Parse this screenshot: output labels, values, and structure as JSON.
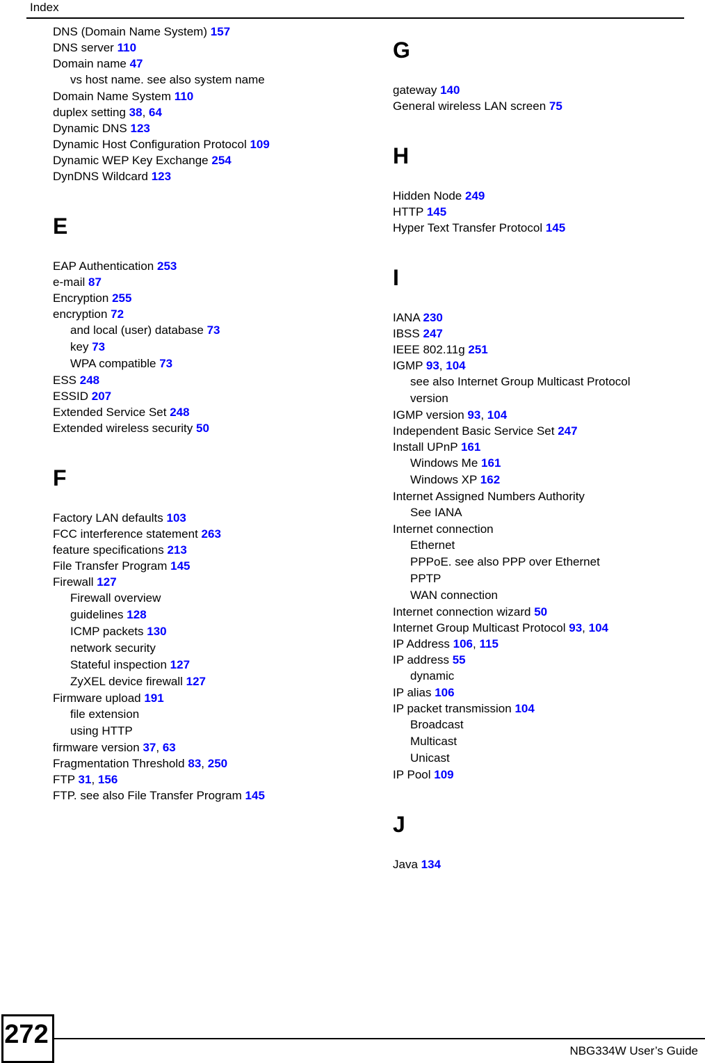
{
  "header": {
    "title": "Index"
  },
  "footer": {
    "page_number": "272",
    "guide_title": "NBG334W User’s Guide"
  },
  "columns": [
    {
      "id": "left",
      "blocks": [
        {
          "type": "entries",
          "entries": [
            {
              "text": "DNS (Domain Name System)",
              "pages": [
                "157"
              ],
              "level": 0
            },
            {
              "text": "DNS server",
              "pages": [
                "110"
              ],
              "level": 0
            },
            {
              "text": "Domain name",
              "pages": [
                "47"
              ],
              "level": 0
            },
            {
              "text": "vs host name. see also system name",
              "pages": [],
              "level": 1
            },
            {
              "text": "Domain Name System",
              "pages": [
                "110"
              ],
              "level": 0
            },
            {
              "text": "duplex setting",
              "pages": [
                "38",
                "64"
              ],
              "level": 0
            },
            {
              "text": "Dynamic DNS",
              "pages": [
                "123"
              ],
              "level": 0
            },
            {
              "text": "Dynamic Host Configuration Protocol",
              "pages": [
                "109"
              ],
              "level": 0
            },
            {
              "text": "Dynamic WEP Key Exchange",
              "pages": [
                "254"
              ],
              "level": 0
            },
            {
              "text": "DynDNS Wildcard",
              "pages": [
                "123"
              ],
              "level": 0
            }
          ]
        },
        {
          "type": "section",
          "letter": "E",
          "entries": [
            {
              "text": "EAP Authentication",
              "pages": [
                "253"
              ],
              "level": 0
            },
            {
              "text": "e-mail",
              "pages": [
                "87"
              ],
              "level": 0
            },
            {
              "text": "Encryption",
              "pages": [
                "255"
              ],
              "level": 0
            },
            {
              "text": "encryption",
              "pages": [
                "72"
              ],
              "level": 0
            },
            {
              "text": "and local (user) database",
              "pages": [
                "73"
              ],
              "level": 1
            },
            {
              "text": "key",
              "pages": [
                "73"
              ],
              "level": 1
            },
            {
              "text": "WPA compatible",
              "pages": [
                "73"
              ],
              "level": 1
            },
            {
              "text": "ESS",
              "pages": [
                "248"
              ],
              "level": 0
            },
            {
              "text": "ESSID",
              "pages": [
                "207"
              ],
              "level": 0
            },
            {
              "text": "Extended Service Set",
              "pages": [
                "248"
              ],
              "level": 0
            },
            {
              "text": "Extended wireless security",
              "pages": [
                "50"
              ],
              "level": 0
            }
          ]
        },
        {
          "type": "section",
          "letter": "F",
          "entries": [
            {
              "text": "Factory LAN defaults",
              "pages": [
                "103"
              ],
              "level": 0
            },
            {
              "text": "FCC interference statement",
              "pages": [
                "263"
              ],
              "level": 0
            },
            {
              "text": "feature specifications",
              "pages": [
                "213"
              ],
              "level": 0
            },
            {
              "text": "File Transfer Program",
              "pages": [
                "145"
              ],
              "level": 0
            },
            {
              "text": "Firewall",
              "pages": [
                "127"
              ],
              "level": 0
            },
            {
              "text": "Firewall overview",
              "pages": [],
              "level": 1
            },
            {
              "text": "guidelines",
              "pages": [
                "128"
              ],
              "level": 1
            },
            {
              "text": "ICMP packets",
              "pages": [
                "130"
              ],
              "level": 1
            },
            {
              "text": "network security",
              "pages": [],
              "level": 1
            },
            {
              "text": "Stateful inspection",
              "pages": [
                "127"
              ],
              "level": 1
            },
            {
              "text": "ZyXEL device firewall",
              "pages": [
                "127"
              ],
              "level": 1
            },
            {
              "text": "Firmware upload",
              "pages": [
                "191"
              ],
              "level": 0
            },
            {
              "text": "file extension",
              "pages": [],
              "level": 1
            },
            {
              "text": "using HTTP",
              "pages": [],
              "level": 1
            },
            {
              "text": "firmware version",
              "pages": [
                "37",
                "63"
              ],
              "level": 0
            },
            {
              "text": "Fragmentation Threshold",
              "pages": [
                "83",
                "250"
              ],
              "level": 0
            },
            {
              "text": "FTP",
              "pages": [
                "31",
                "156"
              ],
              "level": 0
            },
            {
              "text": "FTP. see also File Transfer Program",
              "pages": [
                "145"
              ],
              "level": 0
            }
          ]
        }
      ]
    },
    {
      "id": "right",
      "blocks": [
        {
          "type": "section",
          "letter": "G",
          "first": true,
          "entries": [
            {
              "text": "gateway",
              "pages": [
                "140"
              ],
              "level": 0
            },
            {
              "text": "General wireless LAN screen",
              "pages": [
                "75"
              ],
              "level": 0
            }
          ]
        },
        {
          "type": "section",
          "letter": "H",
          "entries": [
            {
              "text": "Hidden Node",
              "pages": [
                "249"
              ],
              "level": 0
            },
            {
              "text": "HTTP",
              "pages": [
                "145"
              ],
              "level": 0
            },
            {
              "text": "Hyper Text Transfer Protocol",
              "pages": [
                "145"
              ],
              "level": 0
            }
          ]
        },
        {
          "type": "section",
          "letter": "I",
          "entries": [
            {
              "text": "IANA",
              "pages": [
                "230"
              ],
              "level": 0
            },
            {
              "text": "IBSS",
              "pages": [
                "247"
              ],
              "level": 0
            },
            {
              "text": "IEEE 802.11g",
              "pages": [
                "251"
              ],
              "level": 0
            },
            {
              "text": "IGMP",
              "pages": [
                "93",
                "104"
              ],
              "level": 0
            },
            {
              "text": "see also Internet Group Multicast Protocol",
              "pages": [],
              "level": 1
            },
            {
              "text": "version",
              "pages": [],
              "level": 1
            },
            {
              "text": "IGMP version",
              "pages": [
                "93",
                "104"
              ],
              "level": 0
            },
            {
              "text": "Independent Basic Service Set",
              "pages": [
                "247"
              ],
              "level": 0
            },
            {
              "text": "Install UPnP",
              "pages": [
                "161"
              ],
              "level": 0
            },
            {
              "text": "Windows Me",
              "pages": [
                "161"
              ],
              "level": 1
            },
            {
              "text": "Windows XP",
              "pages": [
                "162"
              ],
              "level": 1
            },
            {
              "text": "Internet Assigned Numbers Authority",
              "pages": [],
              "level": 0
            },
            {
              "text": "See IANA",
              "pages": [],
              "level": 1
            },
            {
              "text": "Internet connection",
              "pages": [],
              "level": 0
            },
            {
              "text": "Ethernet",
              "pages": [],
              "level": 1
            },
            {
              "text": "PPPoE. see also PPP over Ethernet",
              "pages": [],
              "level": 1
            },
            {
              "text": "PPTP",
              "pages": [],
              "level": 1
            },
            {
              "text": "WAN connection",
              "pages": [],
              "level": 1
            },
            {
              "text": "Internet connection wizard",
              "pages": [
                "50"
              ],
              "level": 0
            },
            {
              "text": "Internet Group Multicast Protocol",
              "pages": [
                "93",
                "104"
              ],
              "level": 0
            },
            {
              "text": "IP Address",
              "pages": [
                "106",
                "115"
              ],
              "level": 0
            },
            {
              "text": "IP address",
              "pages": [
                "55"
              ],
              "level": 0
            },
            {
              "text": "dynamic",
              "pages": [],
              "level": 1
            },
            {
              "text": "IP alias",
              "pages": [
                "106"
              ],
              "level": 0
            },
            {
              "text": "IP packet transmission",
              "pages": [
                "104"
              ],
              "level": 0
            },
            {
              "text": "Broadcast",
              "pages": [],
              "level": 1
            },
            {
              "text": "Multicast",
              "pages": [],
              "level": 1
            },
            {
              "text": "Unicast",
              "pages": [],
              "level": 1
            },
            {
              "text": "IP Pool",
              "pages": [
                "109"
              ],
              "level": 0
            }
          ]
        },
        {
          "type": "section",
          "letter": "J",
          "entries": [
            {
              "text": "Java",
              "pages": [
                "134"
              ],
              "level": 0
            }
          ]
        }
      ]
    }
  ],
  "colors": {
    "page_reference": "#0000FF",
    "text": "#000000",
    "background": "#FFFFFF"
  }
}
